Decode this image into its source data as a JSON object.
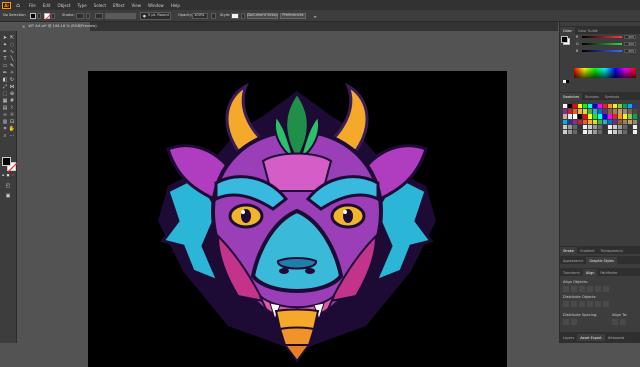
{
  "app": {
    "logo": "Ai",
    "home_icon": "home-icon"
  },
  "menu": [
    "File",
    "Edit",
    "Object",
    "Type",
    "Select",
    "Effect",
    "View",
    "Window",
    "Help"
  ],
  "control_bar": {
    "selection_label": "No Selection",
    "stroke_label": "Stroke:",
    "brush_value": "5 pt. Round",
    "opacity_label": "Opacity:",
    "opacity_value": "100%",
    "style_label": "Style:",
    "doc_setup": "Document Setup",
    "preferences": "Preferences"
  },
  "document": {
    "tab_label": "WT Art.ai* @ 106.16 % (RGB/Preview)"
  },
  "colors": {
    "accent": "#ff9a00",
    "fill": "#000000",
    "stroke_none": "#ff2a2a"
  },
  "panels": {
    "color_tabs": [
      "Color",
      "Color Guide"
    ],
    "rgb": [
      {
        "label": "R",
        "value": "255",
        "color": "#ff3b3b"
      },
      {
        "label": "G",
        "value": "255",
        "color": "#3bd43b"
      },
      {
        "label": "B",
        "value": "255",
        "color": "#3b6bff"
      }
    ],
    "swatch_tabs": [
      "Swatches",
      "Brushes",
      "Symbols"
    ],
    "stroke_tabs": [
      "Stroke",
      "Gradient",
      "Transparency"
    ],
    "appearance_tabs": [
      "Appearance",
      "Graphic Styles"
    ],
    "transform_tabs": [
      "Transform",
      "Align",
      "Pathfinder"
    ],
    "align_objects": "Align Objects:",
    "distribute_objects": "Distribute Objects:",
    "distribute_spacing": "Distribute Spacing:",
    "align_to": "Align To:",
    "bottom_tabs": [
      "Layers",
      "Asset Export",
      "Artboards"
    ]
  }
}
